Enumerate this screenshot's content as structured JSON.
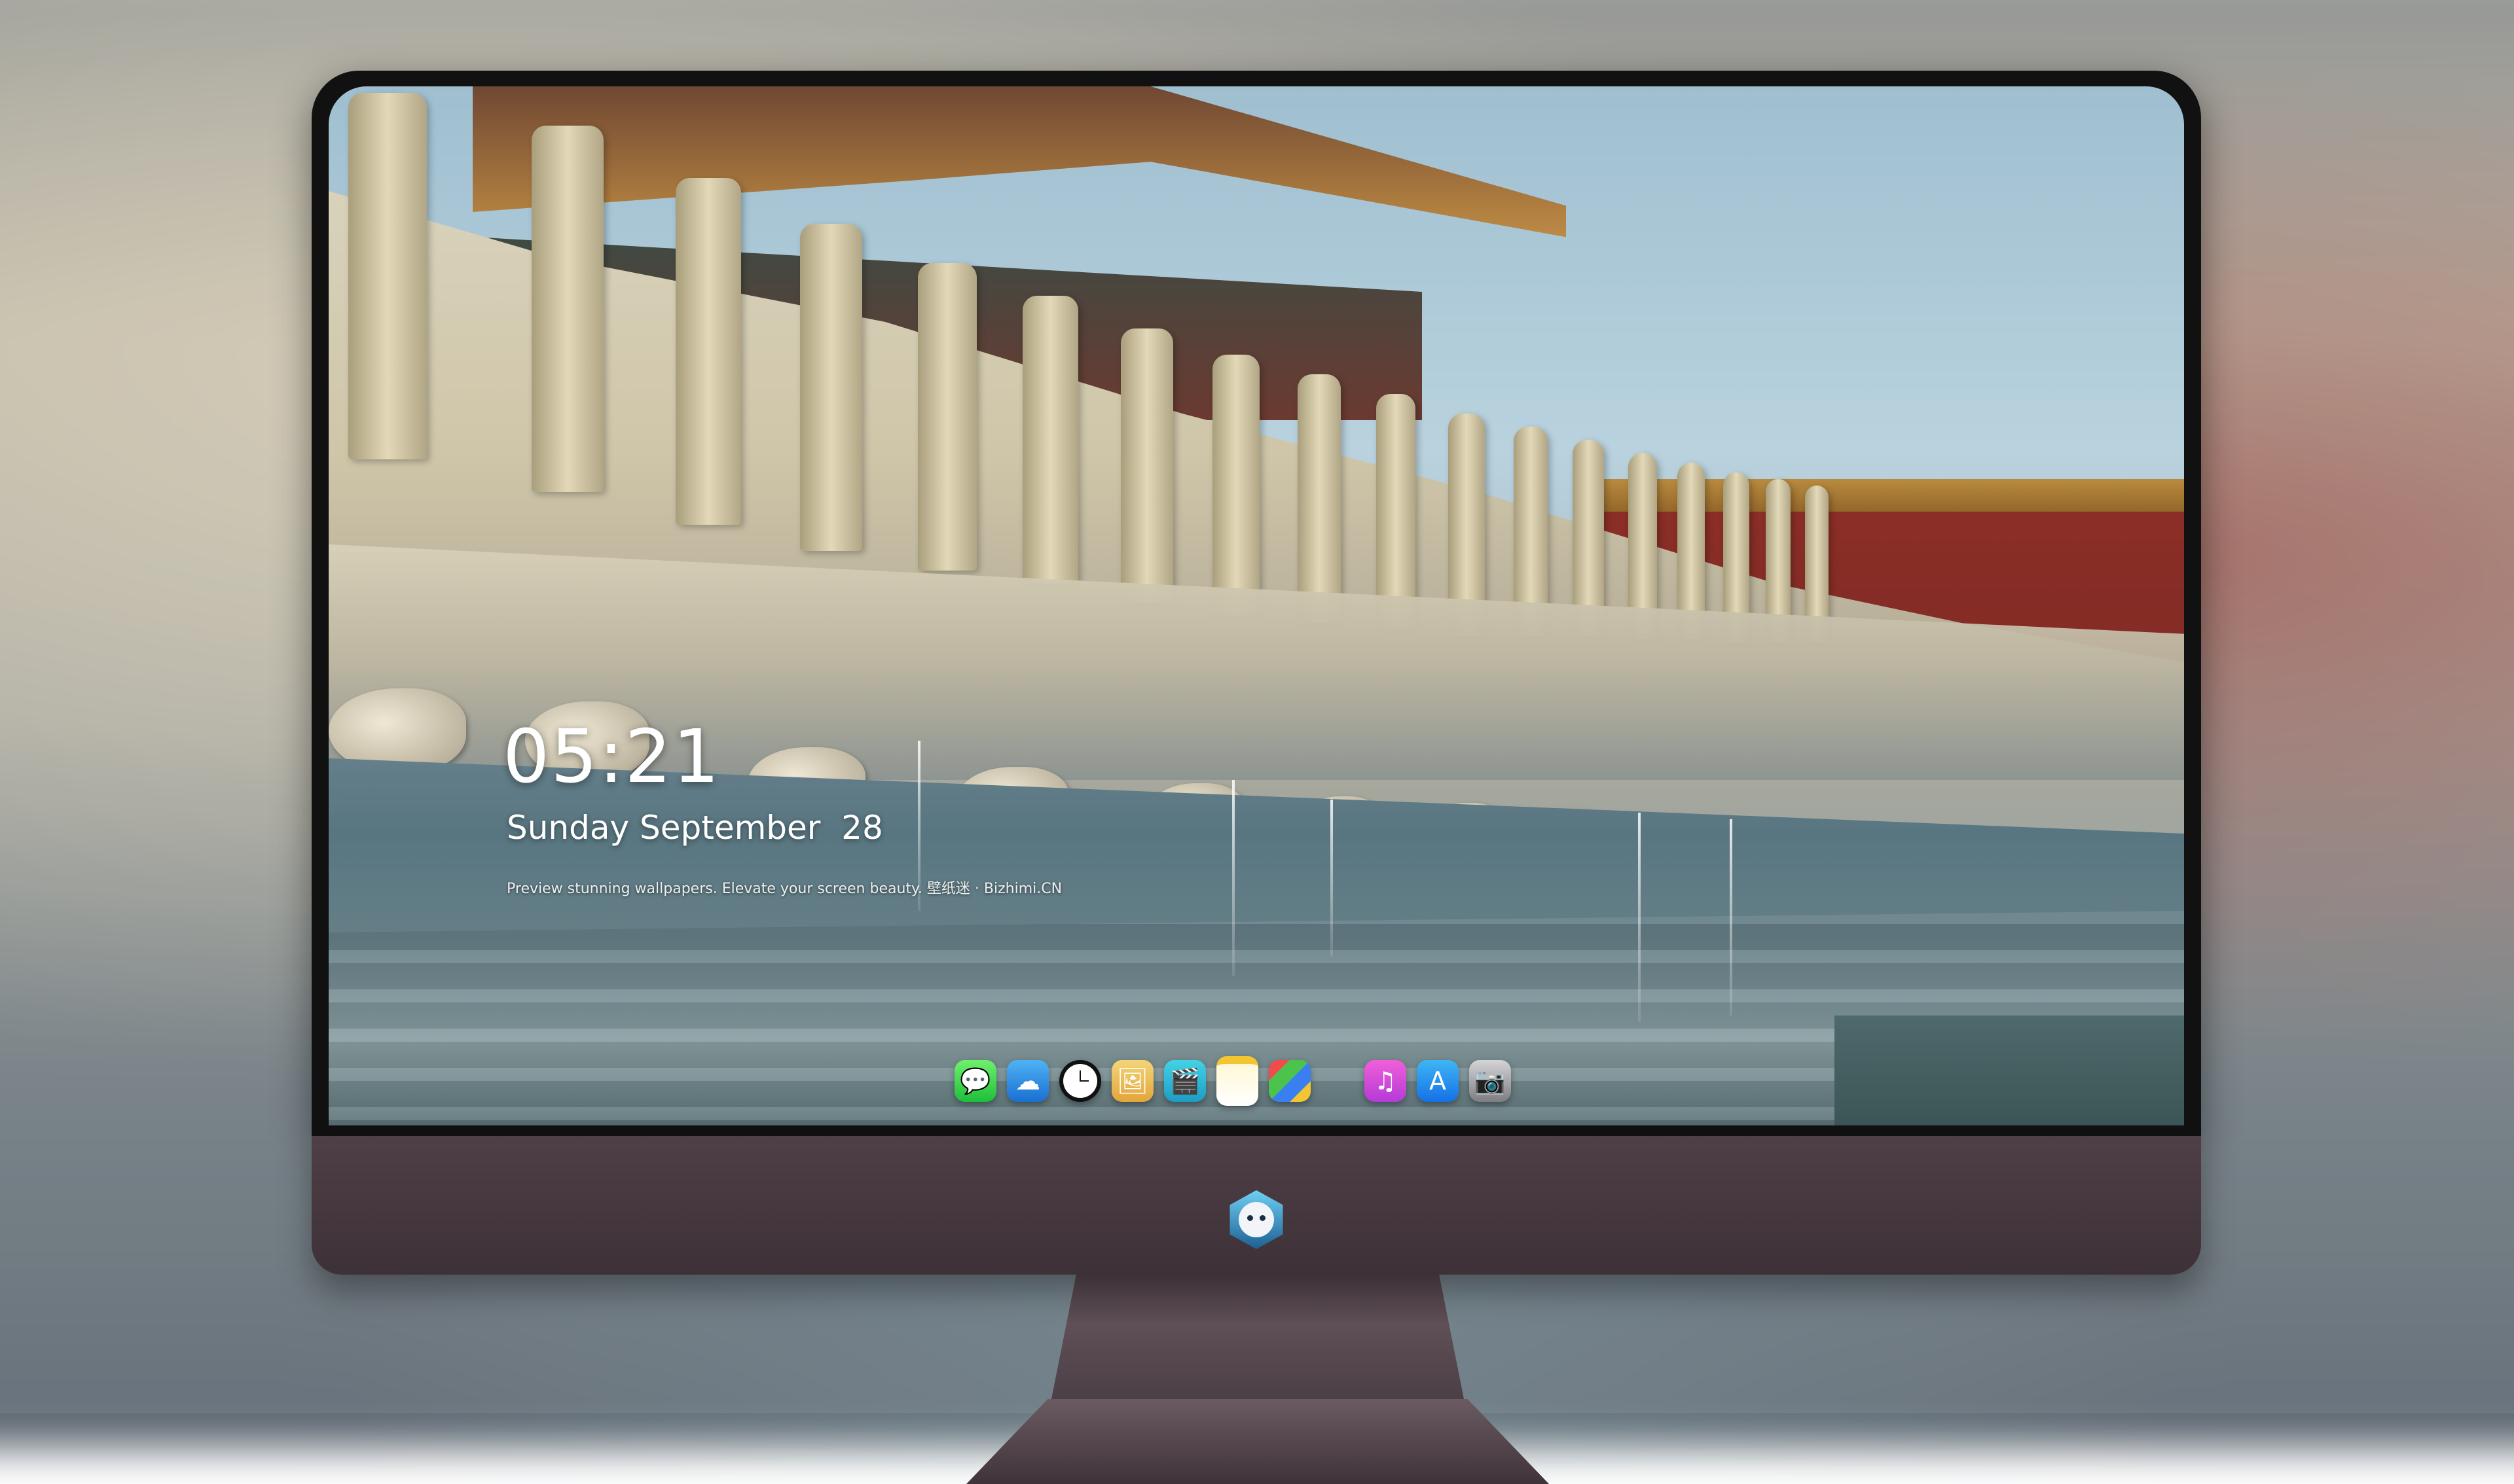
{
  "lockscreen": {
    "time": "05:21",
    "date": "Sunday September  28",
    "tagline": "Preview stunning wallpapers. Elevate your screen beauty. 壁纸迷 · Bizhimi.CN"
  },
  "dock": {
    "apps": [
      {
        "name": "Messages",
        "icon": "messages-icon",
        "glyph": "💬"
      },
      {
        "name": "Weather",
        "icon": "weather-icon",
        "glyph": "☁"
      },
      {
        "name": "Clock",
        "icon": "clock-icon",
        "glyph": ""
      },
      {
        "name": "Preview",
        "icon": "preview-icon",
        "glyph": "🖼"
      },
      {
        "name": "Videos",
        "icon": "video-icon",
        "glyph": "🎬"
      },
      {
        "name": "Notes",
        "icon": "notes-icon",
        "glyph": ""
      },
      {
        "name": "Photos",
        "icon": "photos-icon",
        "glyph": ""
      },
      {
        "name": "Music",
        "icon": "music-icon",
        "glyph": "♫"
      },
      {
        "name": "App Store",
        "icon": "app-store-icon",
        "glyph": "A"
      },
      {
        "name": "Camera",
        "icon": "camera-icon",
        "glyph": "📷"
      }
    ]
  },
  "monitor": {
    "logo": "mascot-logo",
    "bezel_color": "#111111",
    "chin_color": "#4a3b42"
  }
}
